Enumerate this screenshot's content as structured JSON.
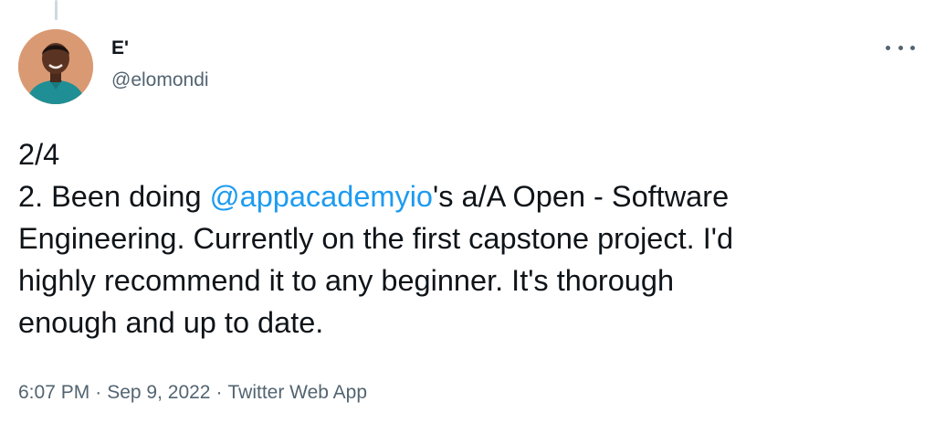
{
  "author": {
    "display_name": "E'",
    "handle": "@elomondi"
  },
  "tweet": {
    "line1": "2/4",
    "line2_prefix": "2. Been doing ",
    "mention": "@appacademyio",
    "line2_suffix": "'s a/A Open - Software",
    "line3": "Engineering. Currently on the first capstone project. I'd",
    "line4": "highly recommend it to any beginner. It's thorough",
    "line5": "enough and up to date."
  },
  "meta": {
    "time": "6:07 PM",
    "separator": "·",
    "date": "Sep 9, 2022",
    "source": "Twitter Web App"
  },
  "icons": {
    "more": "more-horizontal-icon"
  },
  "colors": {
    "mention": "#1d9bf0",
    "secondary_text": "#536471",
    "primary_text": "#0f1419"
  }
}
